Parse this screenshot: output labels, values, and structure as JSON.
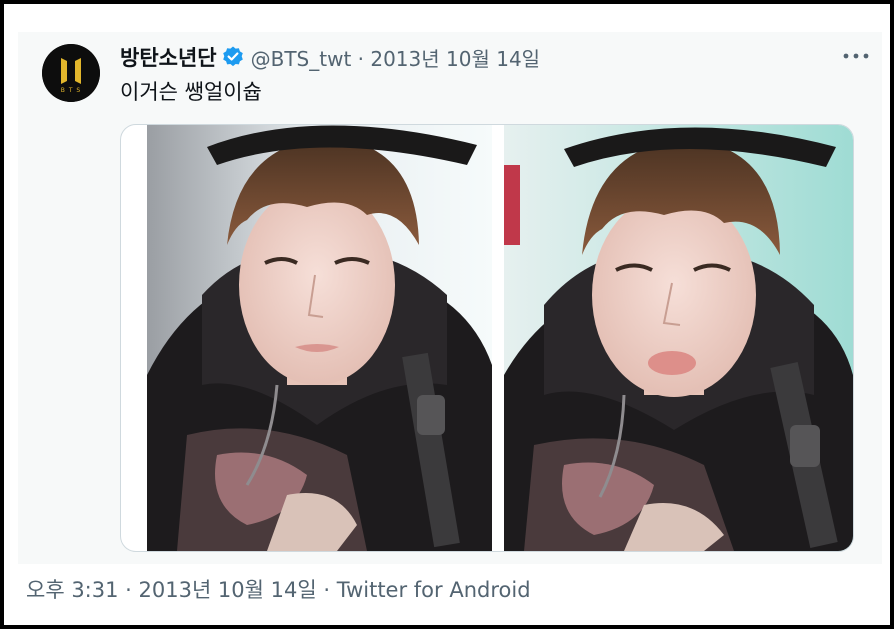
{
  "tweet": {
    "author_name": "방탄소년단",
    "verified": true,
    "meta": "@BTS_twt · 2013년 10월 14일",
    "text": "이거슨 쌩얼이슙",
    "avatar_icon": "bts-logo-icon",
    "more_icon": "more-dots-icon",
    "verified_icon": "verified-badge-icon",
    "verified_color": "#1d9bf0",
    "avatar_color": "#0d0d0d",
    "logo_color": "#e2b62c"
  },
  "media": {
    "photos": [
      "selfie-left",
      "selfie-right"
    ]
  },
  "footer": {
    "timestamp": "오후 3:31 · 2013년 10월 14일 · Twitter for Android"
  }
}
